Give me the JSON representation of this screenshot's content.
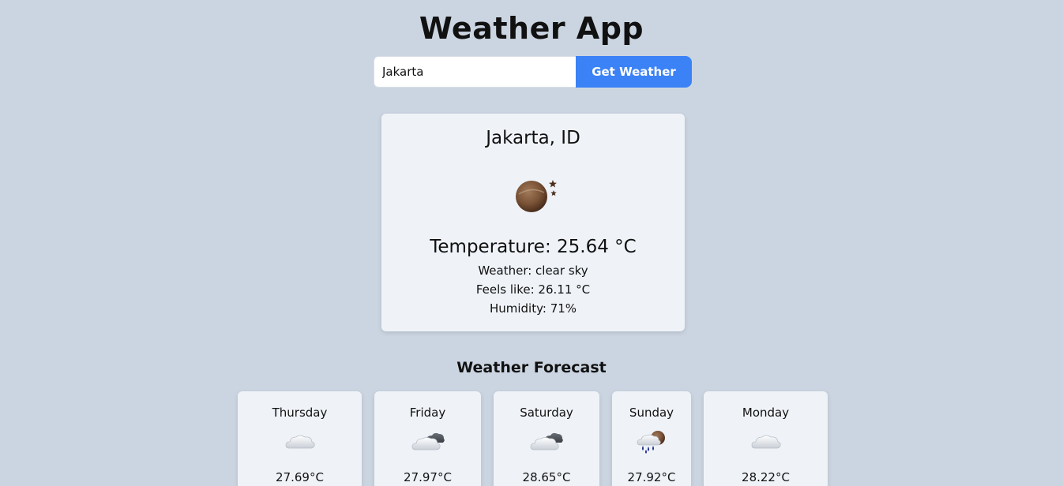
{
  "app": {
    "title": "Weather App"
  },
  "search": {
    "value": "Jakarta",
    "button_label": "Get Weather"
  },
  "current": {
    "location": "Jakarta, ID",
    "icon": "clear-night-icon",
    "temperature": "Temperature: 25.64 °C",
    "weather": "Weather: clear sky",
    "feels_like": "Feels like: 26.11 °C",
    "humidity": "Humidity: 71%"
  },
  "forecast": {
    "title": "Weather Forecast",
    "days": [
      {
        "day": "Thursday",
        "temp": "27.69°C",
        "icon": "cloud-icon"
      },
      {
        "day": "Friday",
        "temp": "27.97°C",
        "icon": "broken-clouds-icon"
      },
      {
        "day": "Saturday",
        "temp": "28.65°C",
        "icon": "broken-clouds-icon"
      },
      {
        "day": "Sunday",
        "temp": "27.92°C",
        "icon": "rain-night-icon"
      },
      {
        "day": "Monday",
        "temp": "28.22°C",
        "icon": "cloud-icon"
      }
    ]
  },
  "colors": {
    "background": "#cbd5e1",
    "card": "#eff3f8",
    "button": "#3b82f6"
  }
}
